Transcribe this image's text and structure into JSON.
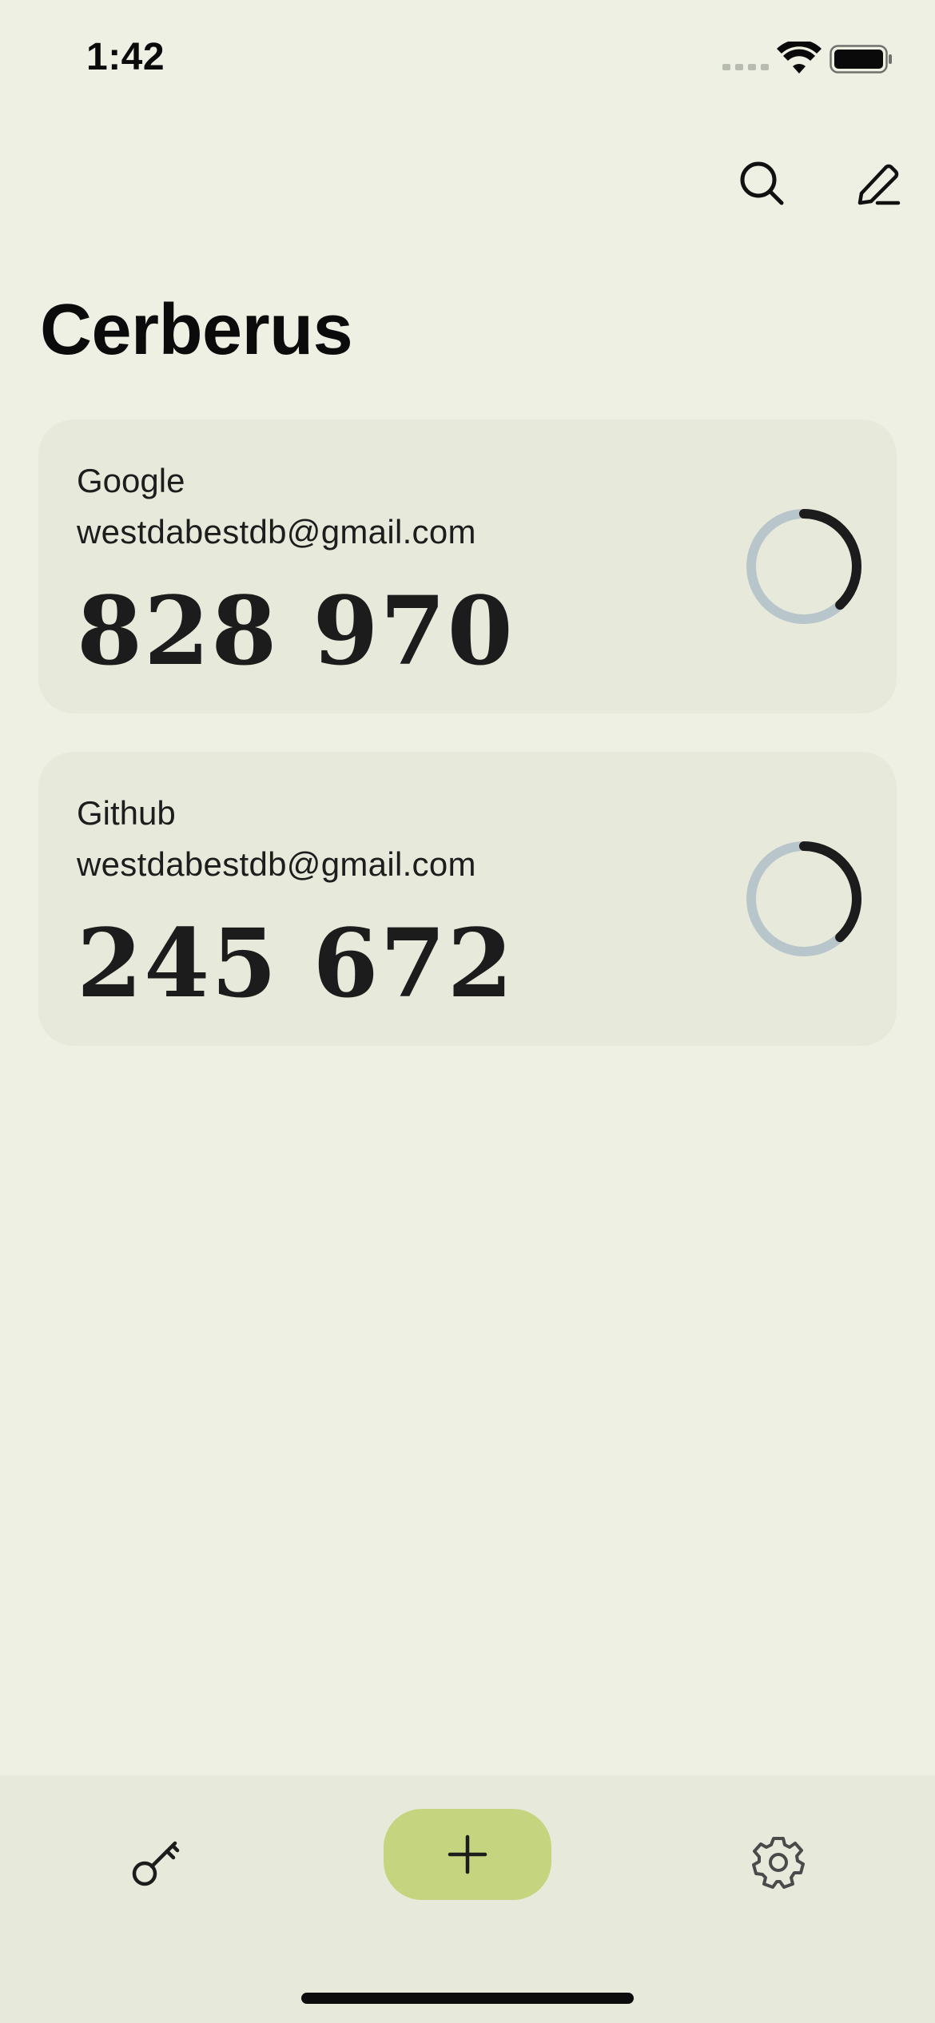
{
  "status_bar": {
    "time": "1:42"
  },
  "header": {
    "title": "Cerberus",
    "search_icon": "search-icon",
    "edit_icon": "pencil-icon"
  },
  "accounts": [
    {
      "issuer": "Google",
      "account": "westdabestdb@gmail.com",
      "code": "828 970",
      "timer_remaining_fraction": 0.38
    },
    {
      "issuer": "Github",
      "account": "westdabestdb@gmail.com",
      "code": "245 672",
      "timer_remaining_fraction": 0.38
    }
  ],
  "bottom_nav": {
    "left_icon": "key-icon",
    "center_icon": "plus-icon",
    "right_icon": "gear-icon"
  },
  "colors": {
    "background": "#eef0e4",
    "card": "#e7eadb",
    "accent": "#c5d57f",
    "timer_track": "#b8c6cc",
    "timer_progress": "#1c1c1c"
  }
}
